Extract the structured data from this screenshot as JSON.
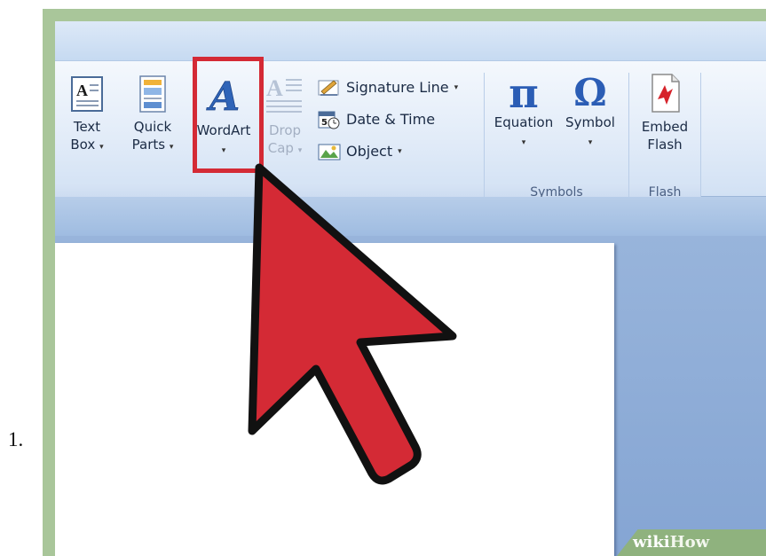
{
  "step_number": "1.",
  "ribbon": {
    "text_group": {
      "text_box": {
        "line1": "Text",
        "line2": "Box",
        "icon": "text-box-icon"
      },
      "quick_parts": {
        "line1": "Quick",
        "line2": "Parts",
        "icon": "quick-parts-icon"
      },
      "wordart": {
        "label": "WordArt",
        "icon": "wordart-icon"
      },
      "drop_cap": {
        "line1": "Drop",
        "line2": "Cap",
        "icon": "drop-cap-icon"
      },
      "signature_line": {
        "label": "Signature Line",
        "icon": "signature-line-icon"
      },
      "date_time": {
        "label": "Date & Time",
        "icon": "date-time-icon"
      },
      "object": {
        "label": "Object",
        "icon": "object-icon"
      }
    },
    "symbols_group": {
      "caption": "Symbols",
      "equation": {
        "label": "Equation",
        "glyph": "π",
        "icon": "pi-icon"
      },
      "symbol": {
        "label": "Symbol",
        "glyph": "Ω",
        "icon": "omega-icon"
      }
    },
    "flash_group": {
      "caption": "Flash",
      "embed_flash": {
        "line1": "Embed",
        "line2": "Flash",
        "icon": "embed-flash-icon"
      }
    }
  },
  "dropdown_glyph": "▾",
  "watermark": {
    "part1": "wiki",
    "part2": "How"
  },
  "colors": {
    "highlight": "#d42a35",
    "pointer_fill": "#d42a35",
    "pointer_stroke": "#111111"
  }
}
